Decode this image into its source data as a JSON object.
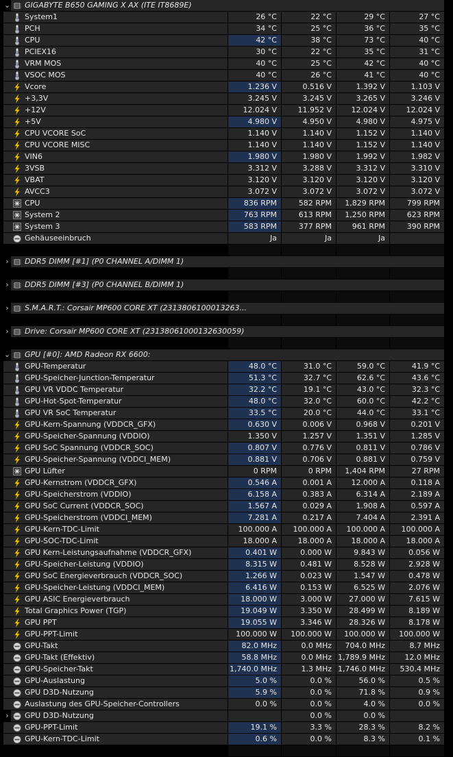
{
  "sections": [
    {
      "title": "GIGABYTE B650 GAMING X AX (ITE IT8689E)",
      "expanded": true,
      "icon": "chip-icon",
      "rows": [
        {
          "label": "System1",
          "icon": "thermometer-icon",
          "values": [
            "26 °C",
            "22 °C",
            "29 °C",
            "27 °C"
          ],
          "hl": false
        },
        {
          "label": "PCH",
          "icon": "thermometer-icon",
          "values": [
            "34 °C",
            "25 °C",
            "36 °C",
            "35 °C"
          ],
          "hl": false
        },
        {
          "label": "CPU",
          "icon": "thermometer-icon",
          "values": [
            "42 °C",
            "38 °C",
            "73 °C",
            "40 °C"
          ],
          "hl": true
        },
        {
          "label": "PCIEX16",
          "icon": "thermometer-icon",
          "values": [
            "30 °C",
            "22 °C",
            "35 °C",
            "31 °C"
          ],
          "hl": false
        },
        {
          "label": "VRM MOS",
          "icon": "thermometer-icon",
          "values": [
            "40 °C",
            "25 °C",
            "42 °C",
            "40 °C"
          ],
          "hl": false
        },
        {
          "label": "VSOC MOS",
          "icon": "thermometer-icon",
          "values": [
            "40 °C",
            "26 °C",
            "41 °C",
            "40 °C"
          ],
          "hl": false
        },
        {
          "label": "Vcore",
          "icon": "lightning-icon",
          "values": [
            "1.236 V",
            "0.516 V",
            "1.392 V",
            "1.103 V"
          ],
          "hl": true
        },
        {
          "label": "+3,3V",
          "icon": "lightning-icon",
          "values": [
            "3.245 V",
            "3.245 V",
            "3.265 V",
            "3.246 V"
          ],
          "hl": false
        },
        {
          "label": "+12V",
          "icon": "lightning-icon",
          "values": [
            "12.024 V",
            "11.952 V",
            "12.024 V",
            "12.024 V"
          ],
          "hl": false
        },
        {
          "label": "+5V",
          "icon": "lightning-icon",
          "values": [
            "4.980 V",
            "4.950 V",
            "4.980 V",
            "4.975 V"
          ],
          "hl": true
        },
        {
          "label": "CPU VCORE SoC",
          "icon": "lightning-icon",
          "values": [
            "1.140 V",
            "1.140 V",
            "1.152 V",
            "1.140 V"
          ],
          "hl": false
        },
        {
          "label": "CPU VCORE MISC",
          "icon": "lightning-icon",
          "values": [
            "1.140 V",
            "1.140 V",
            "1.152 V",
            "1.140 V"
          ],
          "hl": false
        },
        {
          "label": "VIN6",
          "icon": "lightning-icon",
          "values": [
            "1.980 V",
            "1.980 V",
            "1.992 V",
            "1.982 V"
          ],
          "hl": true
        },
        {
          "label": "3VSB",
          "icon": "lightning-icon",
          "values": [
            "3.312 V",
            "3.288 V",
            "3.312 V",
            "3.310 V"
          ],
          "hl": false
        },
        {
          "label": "VBAT",
          "icon": "lightning-icon",
          "values": [
            "3.120 V",
            "3.120 V",
            "3.120 V",
            "3.120 V"
          ],
          "hl": false
        },
        {
          "label": "AVCC3",
          "icon": "lightning-icon",
          "values": [
            "3.072 V",
            "3.072 V",
            "3.072 V",
            "3.072 V"
          ],
          "hl": false
        },
        {
          "label": "CPU",
          "icon": "fan-icon",
          "values": [
            "836 RPM",
            "582 RPM",
            "1,829 RPM",
            "799 RPM"
          ],
          "hl": true
        },
        {
          "label": "System 2",
          "icon": "fan-icon",
          "values": [
            "763 RPM",
            "613 RPM",
            "1,250 RPM",
            "623 RPM"
          ],
          "hl": true
        },
        {
          "label": "System 3",
          "icon": "fan-icon",
          "values": [
            "583 RPM",
            "377 RPM",
            "961 RPM",
            "390 RPM"
          ],
          "hl": true
        },
        {
          "label": "Gehäuseeinbruch",
          "icon": "gauge-icon",
          "values": [
            "Ja",
            "Ja",
            "Ja",
            ""
          ],
          "hl": false
        }
      ]
    },
    {
      "title": "DDR5 DIMM [#1] (P0 CHANNEL A/DIMM 1)",
      "expanded": false,
      "icon": "chip-icon",
      "rows": []
    },
    {
      "title": "DDR5 DIMM [#3] (P0 CHANNEL B/DIMM 1)",
      "expanded": false,
      "icon": "chip-icon",
      "rows": []
    },
    {
      "title": "S.M.A.R.T.: Corsair MP600 CORE XT (2313806100013263...",
      "expanded": false,
      "icon": "chip-icon",
      "rows": []
    },
    {
      "title": "Drive: Corsair MP600 CORE XT (23138061000132630059)",
      "expanded": false,
      "icon": "chip-icon",
      "rows": []
    },
    {
      "title": "GPU [#0]: AMD Radeon RX 6600:",
      "expanded": true,
      "icon": "chip-icon",
      "rows": [
        {
          "label": "GPU-Temperatur",
          "icon": "thermometer-icon",
          "values": [
            "48.0 °C",
            "31.0 °C",
            "59.0 °C",
            "41.9 °C"
          ],
          "hl": true
        },
        {
          "label": "GPU-Speicher-Junction-Temperatur",
          "icon": "thermometer-icon",
          "values": [
            "51.3 °C",
            "32.7 °C",
            "62.6 °C",
            "43.6 °C"
          ],
          "hl": true
        },
        {
          "label": "GPU VR VDDC Temperatur",
          "icon": "thermometer-icon",
          "values": [
            "32.2 °C",
            "19.1 °C",
            "43.0 °C",
            "32.3 °C"
          ],
          "hl": true
        },
        {
          "label": "GPU-Hot-Spot-Temperatur",
          "icon": "thermometer-icon",
          "values": [
            "48.0 °C",
            "32.0 °C",
            "60.0 °C",
            "42.2 °C"
          ],
          "hl": true
        },
        {
          "label": "GPU VR SoC Temperatur",
          "icon": "thermometer-icon",
          "values": [
            "33.5 °C",
            "20.0 °C",
            "44.0 °C",
            "33.1 °C"
          ],
          "hl": true
        },
        {
          "label": "GPU-Kern-Spannung (VDDCR_GFX)",
          "icon": "lightning-icon",
          "values": [
            "0.630 V",
            "0.006 V",
            "0.968 V",
            "0.201 V"
          ],
          "hl": true
        },
        {
          "label": "GPU-Speicher-Spannung (VDDIO)",
          "icon": "lightning-icon",
          "values": [
            "1.350 V",
            "1.257 V",
            "1.351 V",
            "1.285 V"
          ],
          "hl": false
        },
        {
          "label": "GPU SoC Spannung (VDDCR_SOC)",
          "icon": "lightning-icon",
          "values": [
            "0.807 V",
            "0.776 V",
            "0.811 V",
            "0.786 V"
          ],
          "hl": true
        },
        {
          "label": "GPU-Speicher-Spannung (VDDCI_MEM)",
          "icon": "lightning-icon",
          "values": [
            "0.881 V",
            "0.706 V",
            "0.881 V",
            "0.759 V"
          ],
          "hl": true
        },
        {
          "label": "GPU Lüfter",
          "icon": "fan-icon",
          "values": [
            "0 RPM",
            "0 RPM",
            "1,404 RPM",
            "27 RPM"
          ],
          "hl": false
        },
        {
          "label": "GPU-Kernstrom (VDDCR_GFX)",
          "icon": "lightning-icon",
          "values": [
            "0.546 A",
            "0.001 A",
            "12.000 A",
            "0.118 A"
          ],
          "hl": true
        },
        {
          "label": "GPU-Speicherstrom (VDDIO)",
          "icon": "lightning-icon",
          "values": [
            "6.158 A",
            "0.383 A",
            "6.314 A",
            "2.189 A"
          ],
          "hl": true
        },
        {
          "label": "GPU SoC Current (VDDCR_SOC)",
          "icon": "lightning-icon",
          "values": [
            "1.567 A",
            "0.029 A",
            "1.908 A",
            "0.597 A"
          ],
          "hl": true
        },
        {
          "label": "GPU-Speicherstrom (VDDCI_MEM)",
          "icon": "lightning-icon",
          "values": [
            "7.281 A",
            "0.217 A",
            "7.404 A",
            "2.391 A"
          ],
          "hl": true
        },
        {
          "label": "GPU-Kern-TDC-Limit",
          "icon": "lightning-icon",
          "values": [
            "100.000 A",
            "100.000 A",
            "100.000 A",
            "100.000 A"
          ],
          "hl": false
        },
        {
          "label": "GPU-SOC-TDC-Limit",
          "icon": "lightning-icon",
          "values": [
            "18.000 A",
            "18.000 A",
            "18.000 A",
            "18.000 A"
          ],
          "hl": false
        },
        {
          "label": "GPU Kern-Leistungsaufnahme (VDDCR_GFX)",
          "icon": "lightning-icon",
          "values": [
            "0.401 W",
            "0.000 W",
            "9.843 W",
            "0.056 W"
          ],
          "hl": true
        },
        {
          "label": "GPU-Speicher-Leistung (VDDIO)",
          "icon": "lightning-icon",
          "values": [
            "8.315 W",
            "0.481 W",
            "8.528 W",
            "2.928 W"
          ],
          "hl": true
        },
        {
          "label": "GPU SoC Energieverbrauch (VDDCR_SOC)",
          "icon": "lightning-icon",
          "values": [
            "1.266 W",
            "0.023 W",
            "1.547 W",
            "0.478 W"
          ],
          "hl": true
        },
        {
          "label": "GPU-Speicher-Leistung (VDDCI_MEM)",
          "icon": "lightning-icon",
          "values": [
            "6.416 W",
            "0.153 W",
            "6.525 W",
            "2.076 W"
          ],
          "hl": true
        },
        {
          "label": "GPU ASIC Energieverbrauch",
          "icon": "lightning-icon",
          "values": [
            "18.000 W",
            "3.000 W",
            "27.000 W",
            "7.615 W"
          ],
          "hl": true
        },
        {
          "label": "Total Graphics Power (TGP)",
          "icon": "lightning-icon",
          "values": [
            "19.049 W",
            "3.350 W",
            "28.499 W",
            "8.189 W"
          ],
          "hl": true
        },
        {
          "label": "GPU PPT",
          "icon": "lightning-icon",
          "values": [
            "19.055 W",
            "3.346 W",
            "28.326 W",
            "8.178 W"
          ],
          "hl": true
        },
        {
          "label": "GPU-PPT-Limit",
          "icon": "lightning-icon",
          "values": [
            "100.000 W",
            "100.000 W",
            "100.000 W",
            "100.000 W"
          ],
          "hl": false
        },
        {
          "label": "GPU-Takt",
          "icon": "gauge-icon",
          "values": [
            "82.0 MHz",
            "0.0 MHz",
            "704.0 MHz",
            "8.7 MHz"
          ],
          "hl": true
        },
        {
          "label": "GPU-Takt (Effektiv)",
          "icon": "gauge-icon",
          "values": [
            "58.8 MHz",
            "0.0 MHz",
            "1,789.9 MHz",
            "12.0 MHz"
          ],
          "hl": true
        },
        {
          "label": "GPU-Speicher-Takt",
          "icon": "gauge-icon",
          "values": [
            "1,740.0 MHz",
            "1.3 MHz",
            "1,746.0 MHz",
            "530.4 MHz"
          ],
          "hl": true
        },
        {
          "label": "GPU-Auslastung",
          "icon": "gauge-icon",
          "values": [
            "5.0 %",
            "0.0 %",
            "56.0 %",
            "0.5 %"
          ],
          "hl": true
        },
        {
          "label": "GPU D3D-Nutzung",
          "icon": "gauge-icon",
          "values": [
            "5.9 %",
            "0.0 %",
            "71.8 %",
            "0.9 %"
          ],
          "hl": true
        },
        {
          "label": "Auslastung des GPU-Speicher-Controllers",
          "icon": "gauge-icon",
          "values": [
            "0.0 %",
            "0.0 %",
            "4.0 %",
            "0.0 %"
          ],
          "hl": false
        },
        {
          "label": "GPU D3D-Nutzung",
          "icon": "gauge-icon",
          "values": [
            "",
            "0.0 %",
            "0.0 %",
            ""
          ],
          "hl": false,
          "sub": true
        },
        {
          "label": "GPU-PPT-Limit",
          "icon": "gauge-icon",
          "values": [
            "19.1 %",
            "3.3 %",
            "28.3 %",
            "8.2 %"
          ],
          "hl": true
        },
        {
          "label": "GPU-Kern-TDC-Limit",
          "icon": "gauge-icon",
          "values": [
            "0.6 %",
            "0.0 %",
            "8.3 %",
            "0.1 %"
          ],
          "hl": true
        }
      ]
    }
  ],
  "arrows": {
    "expanded": "⌄",
    "collapsed": "›"
  },
  "colors": {
    "highlight": "#203251",
    "cell": "#262626",
    "background": "#000000",
    "lightning": "#f3c400"
  }
}
